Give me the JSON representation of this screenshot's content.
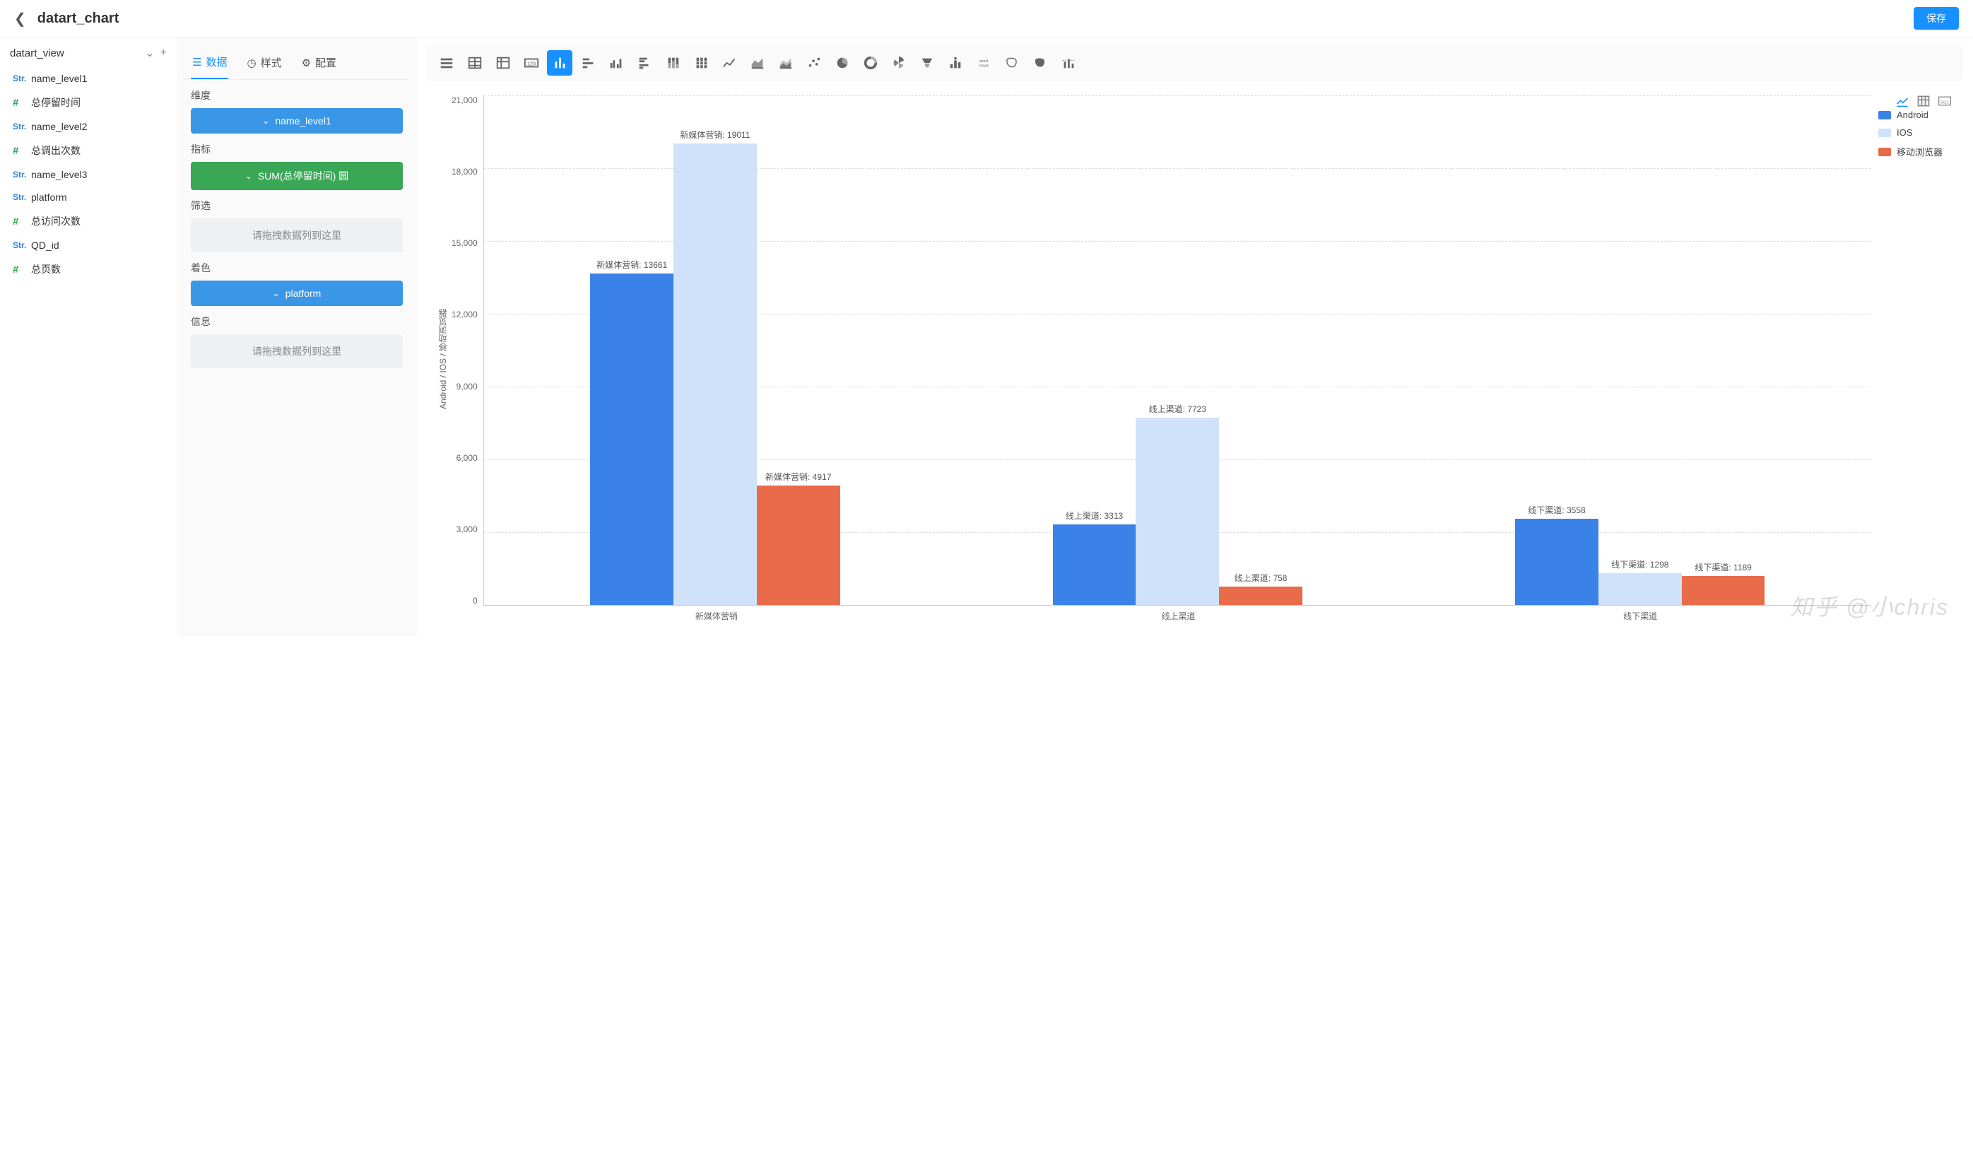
{
  "header": {
    "title": "datart_chart",
    "save_label": "保存"
  },
  "sidebar": {
    "source": "datart_view",
    "fields": [
      {
        "type": "str",
        "name": "name_level1"
      },
      {
        "type": "hash",
        "name": "总停留时间"
      },
      {
        "type": "str",
        "name": "name_level2"
      },
      {
        "type": "hash",
        "name": "总调出次数"
      },
      {
        "type": "str",
        "name": "name_level3"
      },
      {
        "type": "str",
        "name": "platform"
      },
      {
        "type": "hash",
        "name": "总访问次数"
      },
      {
        "type": "str",
        "name": "QD_id"
      },
      {
        "type": "hash",
        "name": "总页数"
      }
    ]
  },
  "tabs": {
    "data": "数据",
    "style": "样式",
    "config": "配置"
  },
  "sections": {
    "dimension": {
      "label": "维度",
      "chip": "name_level1"
    },
    "metric": {
      "label": "指标",
      "chip": "SUM(总停留时间) 圆"
    },
    "filter": {
      "label": "筛选",
      "placeholder": "请拖拽数据列到这里"
    },
    "color": {
      "label": "着色",
      "chip": "platform"
    },
    "info": {
      "label": "信息",
      "placeholder": "请拖拽数据列到这里"
    }
  },
  "chart_types": [
    "list",
    "table",
    "pivot",
    "number",
    "bar",
    "bar-h",
    "bar-group",
    "bar-h-group",
    "bar-stack",
    "bar-stack-full",
    "line",
    "area",
    "area-stack",
    "scatter",
    "pie",
    "donut",
    "rose",
    "funnel",
    "rank",
    "wordcloud",
    "map-china",
    "map-fill",
    "bar-mark"
  ],
  "chart_active": "bar",
  "view_modes": {
    "chart": "chart",
    "table": "table",
    "sql": "SQL"
  },
  "chart_data": {
    "type": "bar",
    "ylabel": "Android / IOS / 移动浏览器",
    "categories": [
      "新媒体营销",
      "线上渠道",
      "线下渠道"
    ],
    "series": [
      {
        "name": "Android",
        "color": "#3a82e8",
        "values": [
          13661,
          3313,
          3558
        ]
      },
      {
        "name": "IOS",
        "color": "#cfe2fa",
        "values": [
          19011,
          7723,
          1298
        ]
      },
      {
        "name": "移动浏览器",
        "color": "#e86b4a",
        "values": [
          4917,
          758,
          1189
        ]
      }
    ],
    "ylim": [
      0,
      21000
    ],
    "yticks": [
      "21,000",
      "18,000",
      "15,000",
      "12,000",
      "9,000",
      "6,000",
      "3,000",
      "0"
    ]
  },
  "watermark": "知乎 @小chris"
}
